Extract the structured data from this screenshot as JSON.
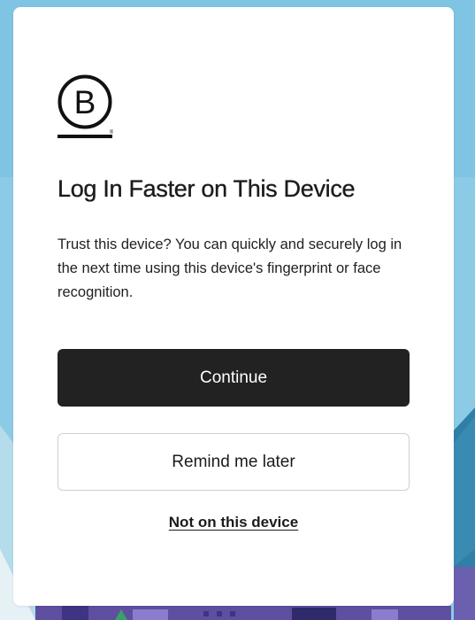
{
  "dialog": {
    "title": "Log In Faster on This Device",
    "description": "Trust this device? You can quickly and securely log in the next time using this device's fingerprint or face recognition.",
    "continue_label": "Continue",
    "remind_label": "Remind me later",
    "not_device_label": "Not on this device"
  },
  "logo": {
    "icon": "b-corp-logo",
    "letter": "B",
    "registered_mark": "®"
  },
  "colors": {
    "primary_button": "#222222",
    "background_sky": "#8ccbe6",
    "text": "#1c1c1c"
  }
}
